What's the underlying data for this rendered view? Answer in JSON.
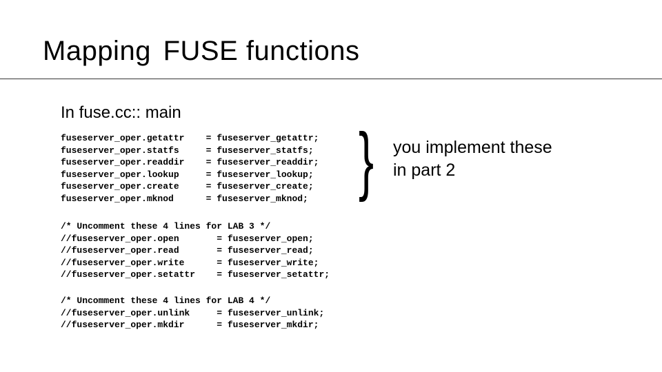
{
  "title_part1": "Mapping",
  "title_part2": "FUSE functions",
  "subtitle": "In fuse.cc:: main",
  "code_block1": "fuseserver_oper.getattr    = fuseserver_getattr;\nfuseserver_oper.statfs     = fuseserver_statfs;\nfuseserver_oper.readdir    = fuseserver_readdir;\nfuseserver_oper.lookup     = fuseserver_lookup;\nfuseserver_oper.create     = fuseserver_create;\nfuseserver_oper.mknod      = fuseserver_mknod;",
  "code_block2": "/* Uncomment these 4 lines for LAB 3 */\n//fuseserver_oper.open       = fuseserver_open;\n//fuseserver_oper.read       = fuseserver_read;\n//fuseserver_oper.write      = fuseserver_write;\n//fuseserver_oper.setattr    = fuseserver_setattr;",
  "code_block3": "/* Uncomment these 4 lines for LAB 4 */\n//fuseserver_oper.unlink     = fuseserver_unlink;\n//fuseserver_oper.mkdir      = fuseserver_mkdir;",
  "brace": "}",
  "annotation_line1": "you implement these",
  "annotation_line2": "in part 2"
}
